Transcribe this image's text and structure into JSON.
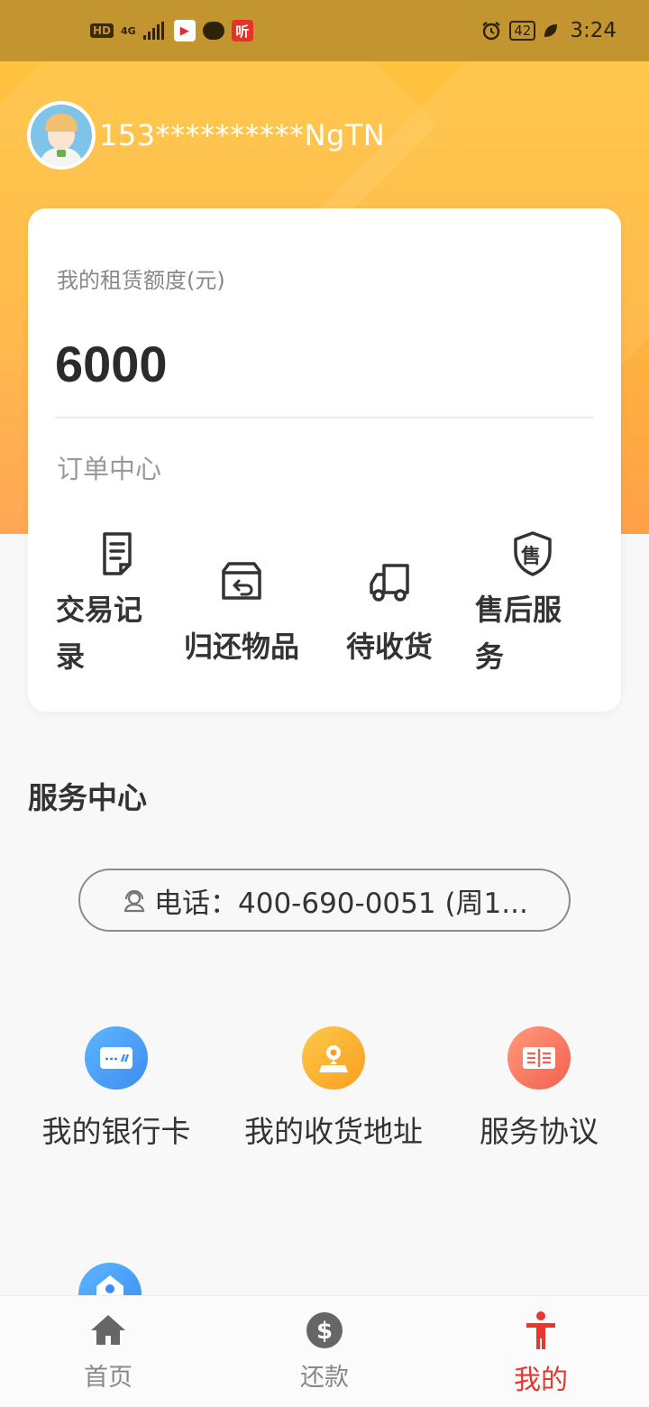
{
  "status_bar": {
    "hd": "HD",
    "network": "4G",
    "app_badge": "听",
    "battery": "42",
    "time": "3:24"
  },
  "profile": {
    "username": "153**********NgTN"
  },
  "quota_card": {
    "label": "我的租赁额度(元)",
    "value": "6000",
    "order_center_label": "订单中心",
    "orders": [
      {
        "label": "交易记录",
        "icon": "document-icon"
      },
      {
        "label": "归还物品",
        "icon": "return-box-icon"
      },
      {
        "label": "待收货",
        "icon": "truck-icon"
      },
      {
        "label": "售后服务",
        "icon": "after-sale-shield-icon"
      }
    ],
    "after_sale_glyph": "售"
  },
  "service_center": {
    "title": "服务中心",
    "phone": "电话：400-690-0051 (周1...",
    "items": [
      {
        "label": "我的银行卡",
        "icon": "bank-card-icon",
        "color": "#4aa3f7"
      },
      {
        "label": "我的收货地址",
        "icon": "location-icon",
        "color": "#fdb333"
      },
      {
        "label": "服务协议",
        "icon": "agreement-book-icon",
        "color": "#f67a65"
      }
    ]
  },
  "tabbar": {
    "tabs": [
      {
        "label": "首页",
        "icon": "home-icon"
      },
      {
        "label": "还款",
        "icon": "dollar-icon"
      },
      {
        "label": "我的",
        "icon": "person-icon",
        "active": true
      }
    ],
    "active_color": "#e8372c"
  }
}
